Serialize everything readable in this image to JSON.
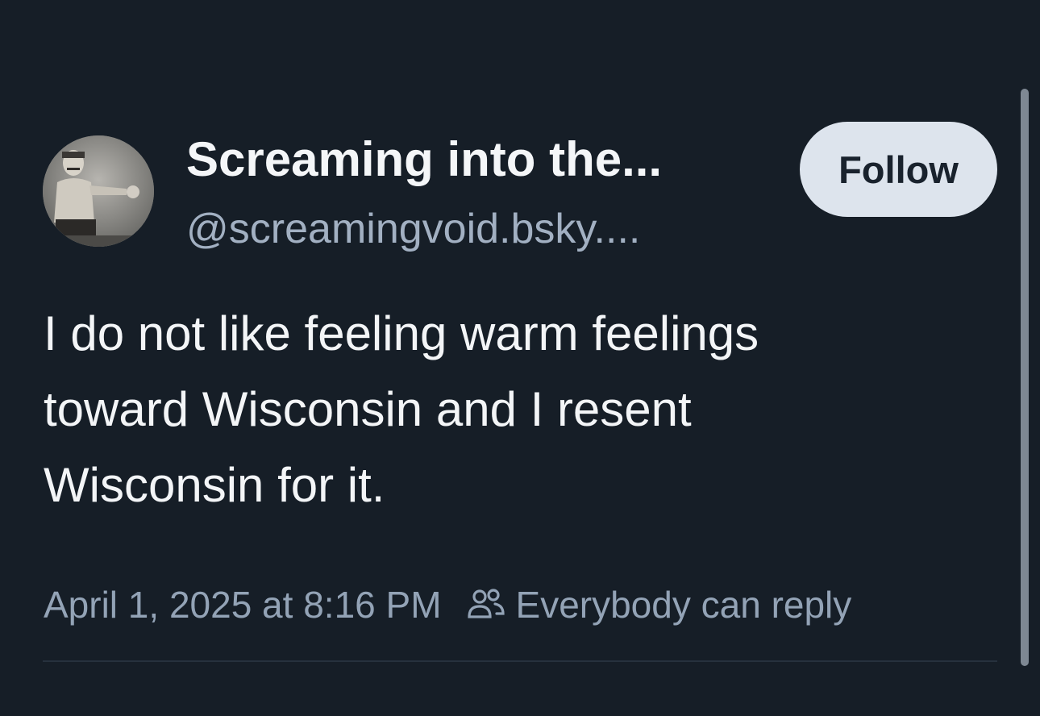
{
  "author": {
    "display_name": "Screaming into the...",
    "handle": "@screamingvoid.bsky...."
  },
  "follow_button": {
    "label": "Follow"
  },
  "post": {
    "text_lines": [
      "I do not like feeling warm feelings",
      "toward Wisconsin and I resent",
      "Wisconsin for it."
    ],
    "timestamp": "April 1, 2025 at 8:16 PM",
    "reply_setting": "Everybody can reply"
  },
  "icons": {
    "reply_setting_icon": "people-icon",
    "avatar": "avatar-image"
  },
  "colors": {
    "background": "#161e27",
    "follow_button_bg": "#dde4ed",
    "secondary_text": "#93a3b6",
    "handle_text": "#a2b0c2"
  }
}
